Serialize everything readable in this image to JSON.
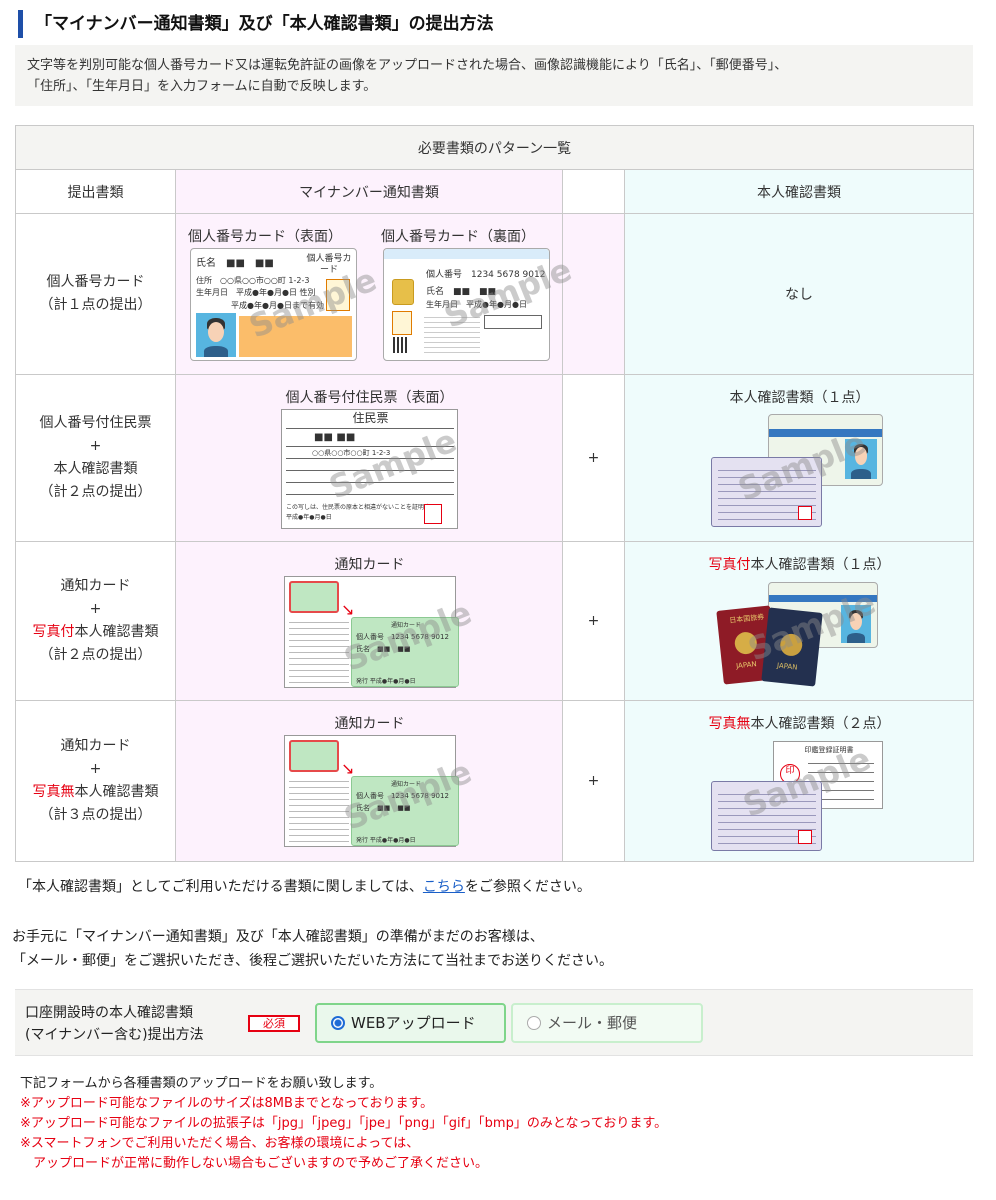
{
  "heading": "「マイナンバー通知書類」及び「本人確認書類」の提出方法",
  "intro": {
    "line1": "文字等を判別可能な個人番号カード又は運転免許証の画像をアップロードされた場合、画像認識機能により「氏名」、「郵便番号」、",
    "line2": "「住所」、「生年月日」を入力フォームに自動で反映します。"
  },
  "table": {
    "caption": "必要書類のパターン一覧",
    "headers": {
      "label": "提出書類",
      "notice": "マイナンバー通知書類",
      "id": "本人確認書類"
    },
    "plus": "+",
    "rows": [
      {
        "label_lines": [
          "個人番号カード",
          "（計１点の提出）"
        ],
        "notice_captions": [
          "個人番号カード（表面）",
          "個人番号カード（裏面）"
        ],
        "id_text": "なし"
      },
      {
        "label_lines": [
          "個人番号付住民票",
          "+",
          "本人確認書類",
          "（計２点の提出）"
        ],
        "notice_captions": [
          "個人番号付住民票（表面）"
        ],
        "id_caption": "本人確認書類（１点）"
      },
      {
        "label_lines": [
          "通知カード",
          "+",
          "本人確認書類",
          "（計２点の提出）"
        ],
        "label_red": "写真付",
        "notice_captions": [
          "通知カード"
        ],
        "id_caption_red": "写真付",
        "id_caption": "本人確認書類（１点）"
      },
      {
        "label_lines": [
          "通知カード",
          "+",
          "本人確認書類",
          "（計３点の提出）"
        ],
        "label_red": "写真無",
        "notice_captions": [
          "通知カード"
        ],
        "id_caption_red": "写真無",
        "id_caption": "本人確認書類（２点）"
      }
    ],
    "card_text": {
      "front_name": "氏名　■■　■■",
      "front_title": "個人番号カード",
      "front_address": "住所　○○県○○市○○町 1-2-3",
      "front_birth": "生年月日　平成●年●月●日 性別",
      "front_expiry": "平成●年●月●日まで有効",
      "back_number": "個人番号　1234 5678 9012",
      "back_name": "氏名　■■　■■",
      "back_birth": "生年月日　平成●年●月●日",
      "juminhyo_title": "住民票",
      "juminhyo_name": "■■ ■■",
      "juminhyo_address": "○○県○○市○○町 1-2-3",
      "juminhyo_footer": "この写しは、住民票の原本と相違がないことを証明する。",
      "juminhyo_date": "平成●年●月●日",
      "tsuchi_title": "通知カード",
      "tsuchi_number": "個人番号　1234 5678 9012",
      "tsuchi_name": "氏名　■■　■■",
      "tsuchi_issue": "発行 平成●年●月●日",
      "inkan_title": "印鑑登録証明書",
      "inkan_seal": "印",
      "passport_label": "日本国旅券",
      "passport_en": "JAPAN",
      "watermark": "Sample"
    }
  },
  "note1": {
    "before": "「本人確認書類」としてご利用いただける書類に関しましては、",
    "link": "こちら",
    "after": "をご参照ください。"
  },
  "note2": {
    "line1": "お手元に「マイナンバー通知書類」及び「本人確認書類」の準備がまだのお客様は、",
    "line2": "「メール・郵便」をご選択いただき、後程ご選択いただいた方法にて当社までお送りください。"
  },
  "method": {
    "label_line1": "口座開設時の本人確認書類",
    "label_line2": "(マイナンバー含む)提出方法",
    "required": "必須",
    "option_web": "WEBアップロード",
    "option_mail": "メール・郵便",
    "selected": "WEBアップロード"
  },
  "instructions": {
    "line1": "下記フォームから各種書類のアップロードをお願い致します。",
    "line2": "※アップロード可能なファイルのサイズは8MBまでとなっております。",
    "line3": "※アップロード可能なファイルの拡張子は「jpg」「jpeg」「jpe」「png」「gif」「bmp」のみとなっております。",
    "line4": "※スマートフォンでご利用いただく場合、お客様の環境によっては、",
    "line5": "　アップロードが正常に動作しない場合もございますので予めご了承ください。"
  },
  "colors": {
    "accent_bar": "#1e4fa8",
    "required_red": "#e60012",
    "notice_bg": "#fdf2fd",
    "id_bg": "#effcfc",
    "selected_border": "#7fd58a",
    "link": "#1a5fc8"
  }
}
